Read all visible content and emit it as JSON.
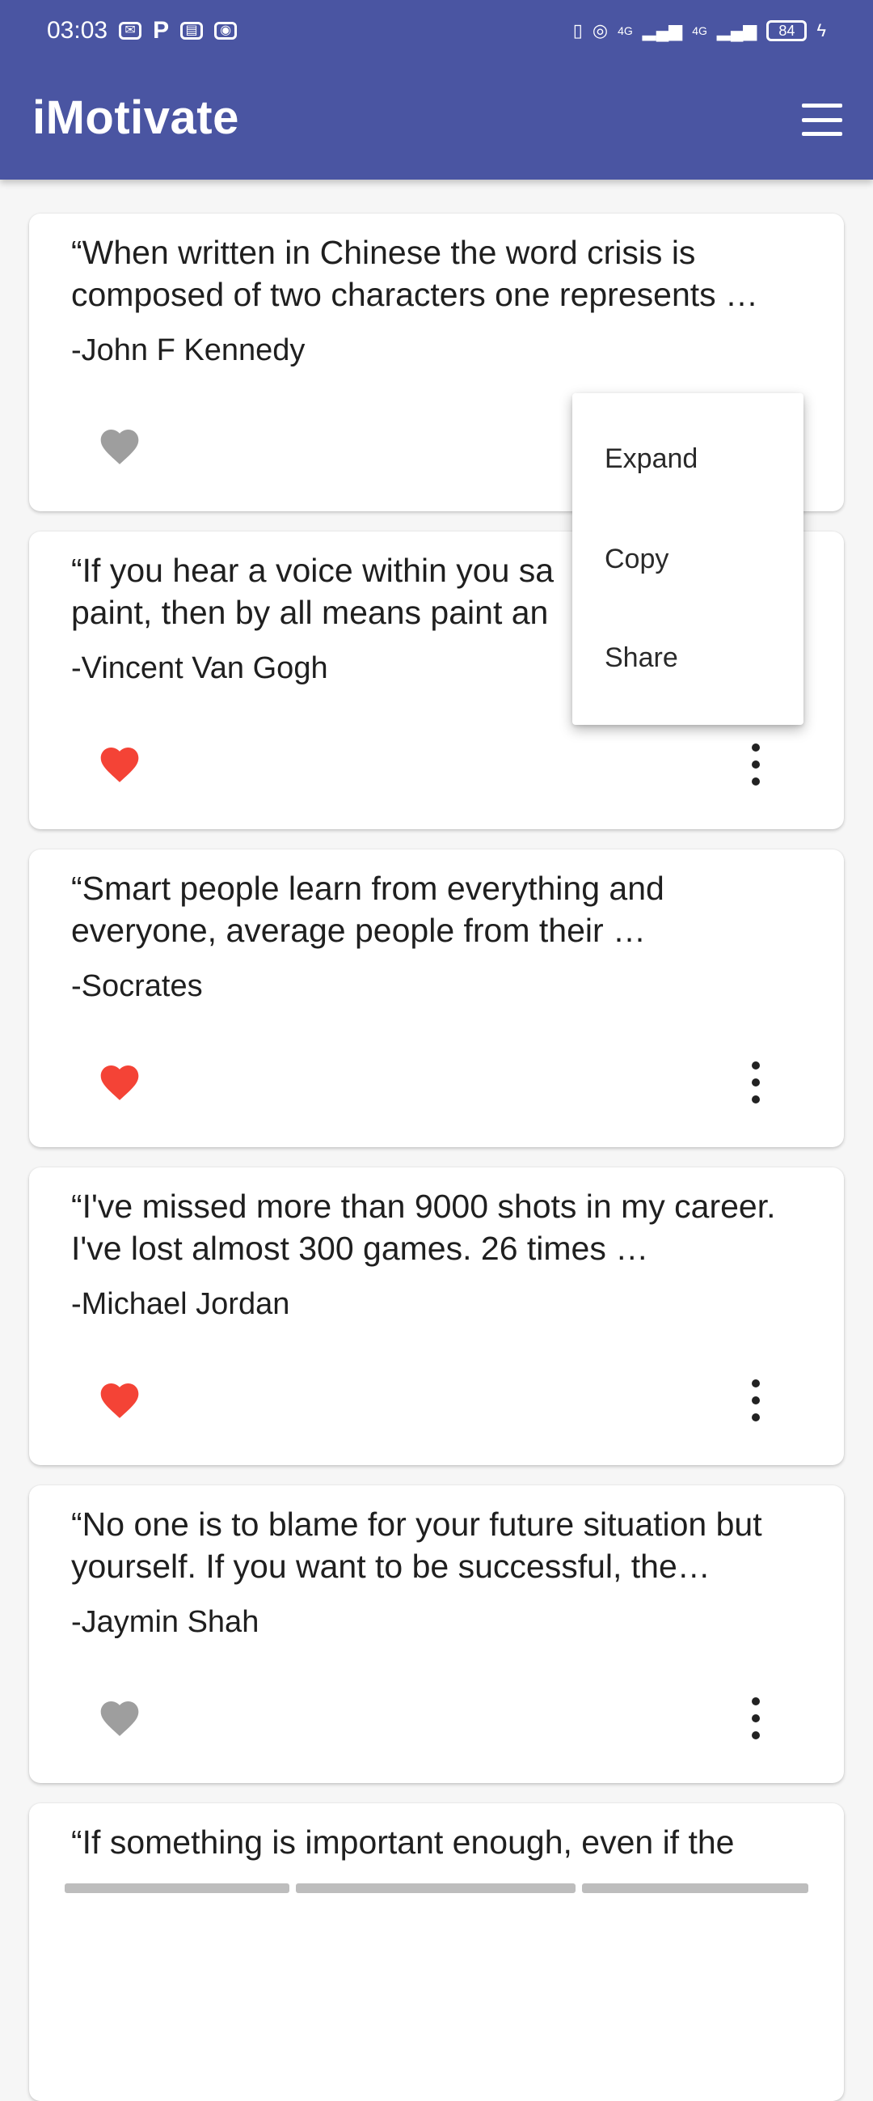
{
  "status_bar": {
    "time": "03:03",
    "left_icons": [
      "mail-icon",
      "p-icon",
      "calendar-icon",
      "record-icon"
    ],
    "right_icons": [
      "vibrate-icon",
      "hotspot-icon",
      "signal-4g-icon",
      "signal-4g-icon-2"
    ],
    "net_label_1": "4G",
    "net_label_2": "4G",
    "battery": "84"
  },
  "app_bar": {
    "title": "iMotivate",
    "menu_icon": "hamburger-menu-icon"
  },
  "quotes": [
    {
      "text": "“When written in Chinese the word crisis is composed of two characters one represents …",
      "author": "-John F Kennedy",
      "liked": false
    },
    {
      "text": "“If you hear a voice within you sa paint, then by all means paint an",
      "author": "-Vincent Van Gogh",
      "liked": true
    },
    {
      "text": "“Smart people learn from everything and everyone, average people from their …",
      "author": "-Socrates",
      "liked": true
    },
    {
      "text": "“I've missed more than 9000 shots in my career. I've lost almost 300 games. 26 times …",
      "author": "-Michael Jordan",
      "liked": true
    },
    {
      "text": "“No one is to blame for your future situation but yourself. If you want to be successful, the…",
      "author": "-Jaymin Shah",
      "liked": false
    },
    {
      "text": "“If something is important enough, even if the",
      "author": "",
      "liked": false
    }
  ],
  "popup_menu": {
    "items": [
      "Expand",
      "Copy",
      "Share"
    ]
  },
  "colors": {
    "app_bar": "#4a55a2",
    "heart_liked": "#f44336",
    "heart_unliked": "#9e9e9e"
  }
}
